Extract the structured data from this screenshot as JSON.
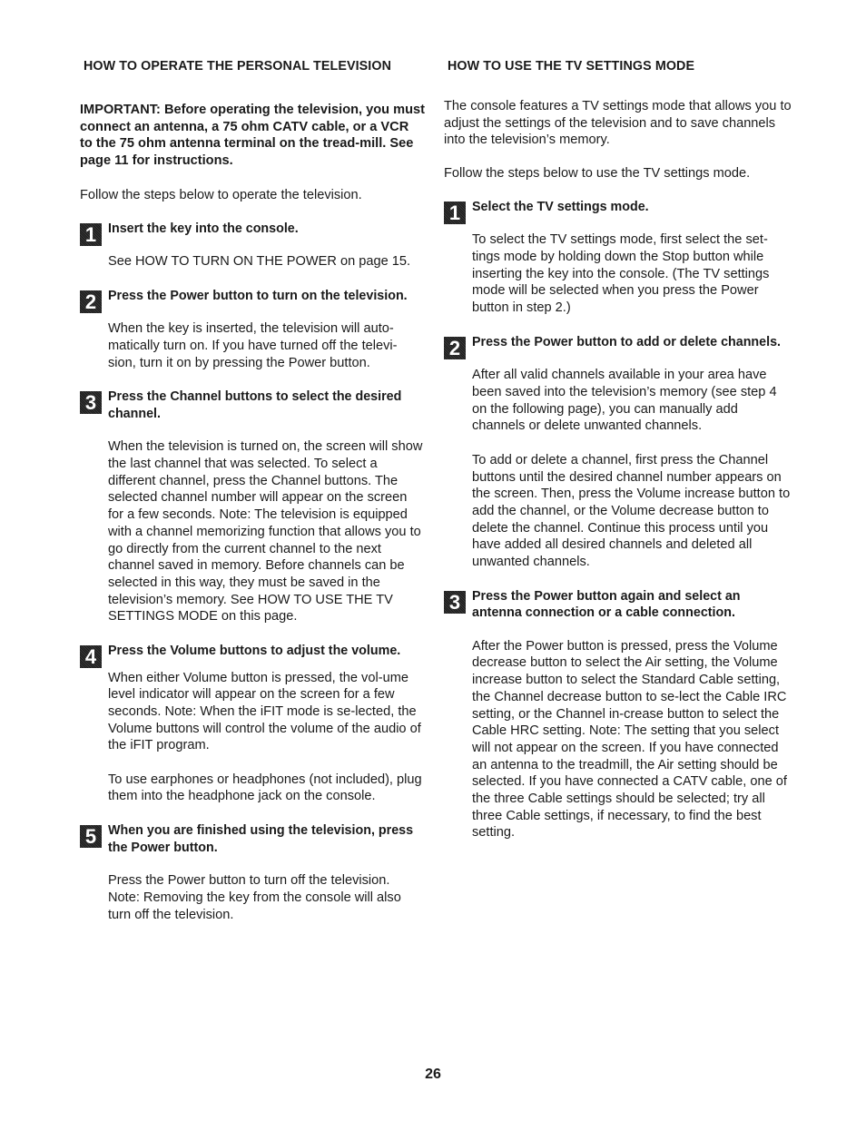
{
  "left": {
    "title": "HOW TO OPERATE THE PERSONAL TELEVISION",
    "important": "IMPORTANT: Before operating the television, you must connect an antenna, a 75 ohm CATV cable, or a VCR to the 75 ohm antenna terminal on the tread-mill. See page 11 for instructions.",
    "intro": "Follow the steps below to operate the television.",
    "steps": [
      {
        "number": "1",
        "heading": "Insert the key into the console.",
        "paragraphs": [
          "See HOW TO TURN ON THE POWER on page 15."
        ]
      },
      {
        "number": "2",
        "heading": "Press the Power button to turn on the television.",
        "paragraphs": [
          "When the key is inserted, the television will auto-matically turn on. If you have turned off the televi-sion, turn it on by pressing the Power button."
        ]
      },
      {
        "number": "3",
        "heading": "Press the Channel buttons to select the desired channel.",
        "paragraphs": [
          "When the television is turned on, the screen will show the last channel that was selected. To select a different channel, press the Channel buttons. The selected channel number will appear on the screen for a few seconds. Note: The television is equipped with a channel memorizing function that allows you to go directly from the current channel to the next channel saved in memory. Before channels can be selected in this way, they must be saved in the television’s memory. See HOW TO USE THE TV SETTINGS MODE on this page."
        ]
      },
      {
        "number": "4",
        "heading": "Press the Volume buttons to adjust the volume.",
        "paragraphs": [
          "When either Volume button is pressed, the vol-ume level indicator will appear on the screen for a few seconds. Note: When the iFIT mode is se-lected, the Volume buttons will control the volume of the audio of the iFIT program.",
          "To use earphones or headphones (not included), plug them into the headphone jack on the console."
        ]
      },
      {
        "number": "5",
        "heading": "When you are finished using the television, press the Power button.",
        "paragraphs": [
          "Press the Power button to turn off the television. Note: Removing the key from the console will also turn off the television."
        ]
      }
    ]
  },
  "right": {
    "title": "HOW TO USE THE TV SETTINGS MODE",
    "intro1": "The console features a TV settings mode that allows you to adjust the settings of the television and to save channels into the television’s memory.",
    "intro2": "Follow the steps below to use the TV settings mode.",
    "steps": [
      {
        "number": "1",
        "heading": "Select the TV settings mode.",
        "paragraphs": [
          "To select the TV settings mode, first select the set-tings mode by holding down the Stop button while inserting the key into the console. (The TV settings mode will be selected when you press the Power button in step 2.)"
        ]
      },
      {
        "number": "2",
        "heading": "Press the Power button to add or delete channels.",
        "paragraphs": [
          "After all valid channels available in your area have been saved into the television’s memory (see step 4 on the following page), you can manually add channels or delete unwanted channels.",
          "To add or delete a channel, first press the Channel buttons until the desired channel number appears on the screen. Then, press the Volume increase button to add the channel, or the Volume decrease button to delete the channel. Continue this process until you have added all desired channels and deleted all unwanted channels."
        ]
      },
      {
        "number": "3",
        "heading": "Press the Power button again and select an antenna connection or a cable connection.",
        "paragraphs": [
          "After the Power button is pressed, press the Volume decrease button to select the Air setting, the Volume increase button to select the Standard Cable setting, the Channel decrease button to se-lect the Cable IRC setting, or the Channel in-crease button to select the Cable HRC setting. Note: The setting that you select will not appear on the screen. If you have connected an antenna to the treadmill, the Air setting should be selected. If you have connected a CATV cable, one of the three Cable settings should be selected; try all three Cable settings, if necessary, to find the best setting."
        ]
      }
    ]
  },
  "page_number": "26"
}
